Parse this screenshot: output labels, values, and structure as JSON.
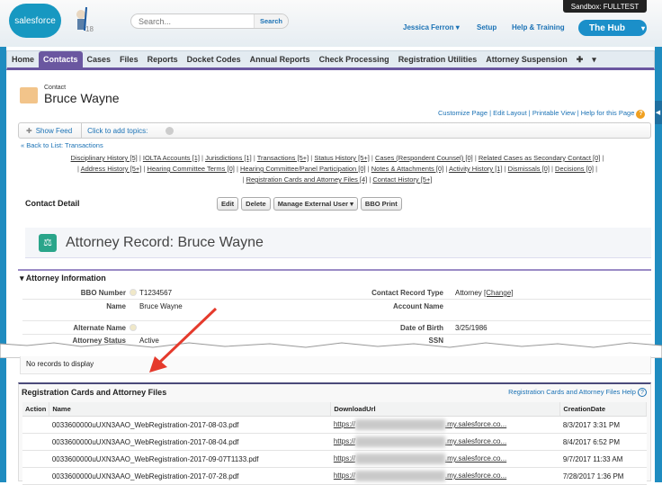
{
  "header": {
    "logo_text": "salesforce",
    "version_badge": "18",
    "search_placeholder": "Search...",
    "search_button": "Search",
    "user_menu": "Jessica Ferron",
    "setup": "Setup",
    "help_training": "Help & Training",
    "app_switcher": "The Hub",
    "sandbox": "Sandbox:  FULLTEST"
  },
  "tabs": [
    "Home",
    "Contacts",
    "Cases",
    "Files",
    "Reports",
    "Docket Codes",
    "Annual Reports",
    "Check Processing",
    "Registration Utilities",
    "Attorney Suspension"
  ],
  "record": {
    "type_label": "Contact",
    "name": "Bruce Wayne",
    "page_links": [
      "Customize Page",
      "Edit Layout",
      "Printable View",
      "Help for this Page"
    ],
    "show_feed": "Show Feed",
    "add_topics": "Click to add topics:",
    "back_link": "« Back to List: Transactions"
  },
  "related_links": [
    "Disciplinary History [5]",
    "IOLTA Accounts [1]",
    "Jurisdictions [1]",
    "Transactions [5+]",
    "Status History [5+]",
    "Cases (Respondent Counsel) [0]",
    "Related Cases as Secondary Contact [0]",
    "Address History [5+]",
    "Hearing Committee Terms [0]",
    "Hearing Committee/Panel Participation [0]",
    "Notes & Attachments [0]",
    "Activity History [1]",
    "Dismissals [0]",
    "Decisions [0]",
    "Registration Cards and Attorney Files [4]",
    "Contact History [5+]"
  ],
  "detail": {
    "title": "Contact Detail",
    "buttons": [
      "Edit",
      "Delete",
      "Manage External User",
      "BBO Print"
    ],
    "banner": "Attorney Record: Bruce Wayne",
    "section": "Attorney Information",
    "fields": {
      "bbo_label": "BBO Number",
      "bbo": "T1234567",
      "name_label": "Name",
      "name": "Bruce Wayne",
      "alt_label": "Alternate Name",
      "status_label": "Attorney Status",
      "status": "Active",
      "crt_label": "Contact Record Type",
      "crt": "Attorney",
      "change": "[Change]",
      "account_label": "Account Name",
      "dob_label": "Date of Birth",
      "dob": "3/25/1986",
      "ssn_label": "SSN"
    }
  },
  "no_records": "No records to display",
  "files": {
    "title": "Registration Cards and Attorney Files",
    "help": "Registration Cards and Attorney Files Help",
    "columns": [
      "Action",
      "Name",
      "DownloadUrl",
      "CreationDate"
    ],
    "rows": [
      {
        "name": "0033600000uUXN3AAO_WebRegistration-2017-08-03.pdf",
        "url_start": "https://",
        "url_end": ".my.salesforce.co...",
        "date": "8/3/2017 3:31 PM"
      },
      {
        "name": "0033600000uUXN3AAO_WebRegistration-2017-08-04.pdf",
        "url_start": "https://",
        "url_end": ".my.salesforce.co...",
        "date": "8/4/2017 6:52 PM"
      },
      {
        "name": "0033600000uUXN3AAO_WebRegistration-2017-09-07T1133.pdf",
        "url_start": "https://",
        "url_end": ".my.salesforce.co...",
        "date": "9/7/2017 11:33 AM"
      },
      {
        "name": "0033600000uUXN3AAO_WebRegistration-2017-07-28.pdf",
        "url_start": "https://",
        "url_end": ".my.salesforce.co...",
        "date": "7/28/2017 1:36 PM"
      }
    ]
  }
}
